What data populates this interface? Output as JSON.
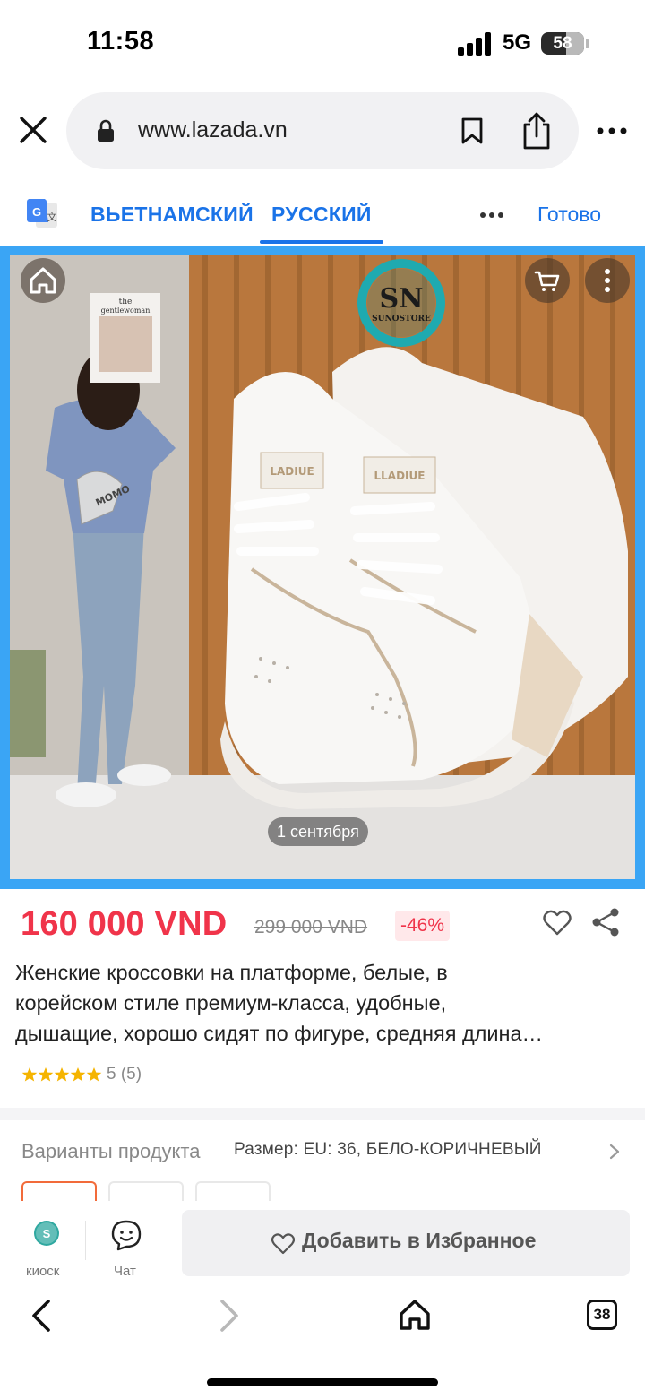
{
  "status_bar": {
    "time": "11:58",
    "network": "5G",
    "battery": "58",
    "battery_level": 0.58
  },
  "url_bar": {
    "url": "www.lazada.vn"
  },
  "translate_bar": {
    "source_lang": "ВЬЕТНАМСКИЙ",
    "target_lang": "РУССКИЙ",
    "done": "Готово"
  },
  "product_image": {
    "brand_line1": "SN",
    "brand_line2": "SUNOSTORE",
    "magazine_line1": "the",
    "magazine_line2": "gentlewoman",
    "bag_text": "MOMO",
    "shoe_tab_1": "LADIUE",
    "shoe_tab_2": "LLADIUE",
    "date_chip": "1 сентября"
  },
  "pricing": {
    "price": "160 000 VND",
    "old_price": "299 000 VND",
    "discount": "-46%"
  },
  "product": {
    "title_lines": [
      "Женские кроссовки на платформе, белые, в",
      "корейском стиле премиум-класса, удобные,",
      "дышащие, хорошо сидят по фигуре, средняя длина…"
    ],
    "rating_value": 5,
    "rating_text": "5 (5)"
  },
  "variants": {
    "label": "Варианты продукта",
    "value": "Размер: EU: 36, БЕЛО-КОРИЧНЕВЫЙ"
  },
  "action_bar": {
    "kiosk_label": "киоск",
    "chat_label": "Чат",
    "favorite_label": "Добавить в Избранное"
  },
  "browser_toolbar": {
    "tab_count": "38"
  },
  "colors": {
    "accent_blue": "#1a73e8",
    "frame_blue": "#3aa5f5",
    "price_red": "#f0344a",
    "star_yellow": "#f5b400"
  }
}
